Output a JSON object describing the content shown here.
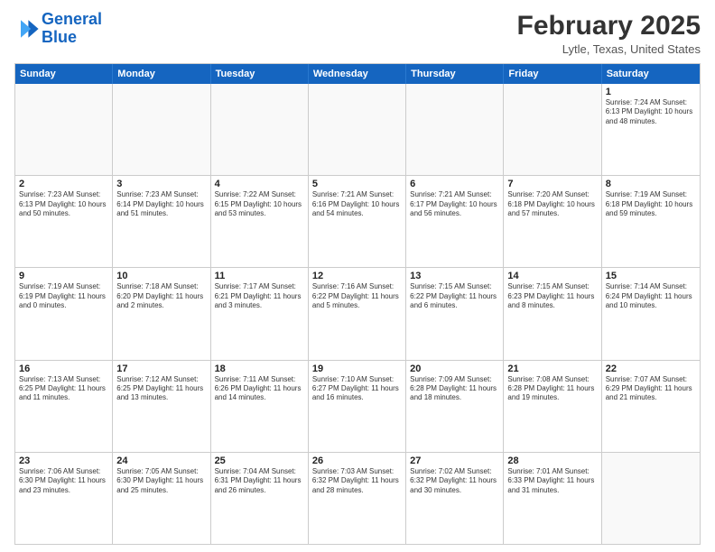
{
  "header": {
    "logo_line1": "General",
    "logo_line2": "Blue",
    "title": "February 2025",
    "subtitle": "Lytle, Texas, United States"
  },
  "weekdays": [
    "Sunday",
    "Monday",
    "Tuesday",
    "Wednesday",
    "Thursday",
    "Friday",
    "Saturday"
  ],
  "weeks": [
    [
      {
        "day": "",
        "info": ""
      },
      {
        "day": "",
        "info": ""
      },
      {
        "day": "",
        "info": ""
      },
      {
        "day": "",
        "info": ""
      },
      {
        "day": "",
        "info": ""
      },
      {
        "day": "",
        "info": ""
      },
      {
        "day": "1",
        "info": "Sunrise: 7:24 AM\nSunset: 6:13 PM\nDaylight: 10 hours and 48 minutes."
      }
    ],
    [
      {
        "day": "2",
        "info": "Sunrise: 7:23 AM\nSunset: 6:13 PM\nDaylight: 10 hours and 50 minutes."
      },
      {
        "day": "3",
        "info": "Sunrise: 7:23 AM\nSunset: 6:14 PM\nDaylight: 10 hours and 51 minutes."
      },
      {
        "day": "4",
        "info": "Sunrise: 7:22 AM\nSunset: 6:15 PM\nDaylight: 10 hours and 53 minutes."
      },
      {
        "day": "5",
        "info": "Sunrise: 7:21 AM\nSunset: 6:16 PM\nDaylight: 10 hours and 54 minutes."
      },
      {
        "day": "6",
        "info": "Sunrise: 7:21 AM\nSunset: 6:17 PM\nDaylight: 10 hours and 56 minutes."
      },
      {
        "day": "7",
        "info": "Sunrise: 7:20 AM\nSunset: 6:18 PM\nDaylight: 10 hours and 57 minutes."
      },
      {
        "day": "8",
        "info": "Sunrise: 7:19 AM\nSunset: 6:18 PM\nDaylight: 10 hours and 59 minutes."
      }
    ],
    [
      {
        "day": "9",
        "info": "Sunrise: 7:19 AM\nSunset: 6:19 PM\nDaylight: 11 hours and 0 minutes."
      },
      {
        "day": "10",
        "info": "Sunrise: 7:18 AM\nSunset: 6:20 PM\nDaylight: 11 hours and 2 minutes."
      },
      {
        "day": "11",
        "info": "Sunrise: 7:17 AM\nSunset: 6:21 PM\nDaylight: 11 hours and 3 minutes."
      },
      {
        "day": "12",
        "info": "Sunrise: 7:16 AM\nSunset: 6:22 PM\nDaylight: 11 hours and 5 minutes."
      },
      {
        "day": "13",
        "info": "Sunrise: 7:15 AM\nSunset: 6:22 PM\nDaylight: 11 hours and 6 minutes."
      },
      {
        "day": "14",
        "info": "Sunrise: 7:15 AM\nSunset: 6:23 PM\nDaylight: 11 hours and 8 minutes."
      },
      {
        "day": "15",
        "info": "Sunrise: 7:14 AM\nSunset: 6:24 PM\nDaylight: 11 hours and 10 minutes."
      }
    ],
    [
      {
        "day": "16",
        "info": "Sunrise: 7:13 AM\nSunset: 6:25 PM\nDaylight: 11 hours and 11 minutes."
      },
      {
        "day": "17",
        "info": "Sunrise: 7:12 AM\nSunset: 6:25 PM\nDaylight: 11 hours and 13 minutes."
      },
      {
        "day": "18",
        "info": "Sunrise: 7:11 AM\nSunset: 6:26 PM\nDaylight: 11 hours and 14 minutes."
      },
      {
        "day": "19",
        "info": "Sunrise: 7:10 AM\nSunset: 6:27 PM\nDaylight: 11 hours and 16 minutes."
      },
      {
        "day": "20",
        "info": "Sunrise: 7:09 AM\nSunset: 6:28 PM\nDaylight: 11 hours and 18 minutes."
      },
      {
        "day": "21",
        "info": "Sunrise: 7:08 AM\nSunset: 6:28 PM\nDaylight: 11 hours and 19 minutes."
      },
      {
        "day": "22",
        "info": "Sunrise: 7:07 AM\nSunset: 6:29 PM\nDaylight: 11 hours and 21 minutes."
      }
    ],
    [
      {
        "day": "23",
        "info": "Sunrise: 7:06 AM\nSunset: 6:30 PM\nDaylight: 11 hours and 23 minutes."
      },
      {
        "day": "24",
        "info": "Sunrise: 7:05 AM\nSunset: 6:30 PM\nDaylight: 11 hours and 25 minutes."
      },
      {
        "day": "25",
        "info": "Sunrise: 7:04 AM\nSunset: 6:31 PM\nDaylight: 11 hours and 26 minutes."
      },
      {
        "day": "26",
        "info": "Sunrise: 7:03 AM\nSunset: 6:32 PM\nDaylight: 11 hours and 28 minutes."
      },
      {
        "day": "27",
        "info": "Sunrise: 7:02 AM\nSunset: 6:32 PM\nDaylight: 11 hours and 30 minutes."
      },
      {
        "day": "28",
        "info": "Sunrise: 7:01 AM\nSunset: 6:33 PM\nDaylight: 11 hours and 31 minutes."
      },
      {
        "day": "",
        "info": ""
      }
    ]
  ]
}
